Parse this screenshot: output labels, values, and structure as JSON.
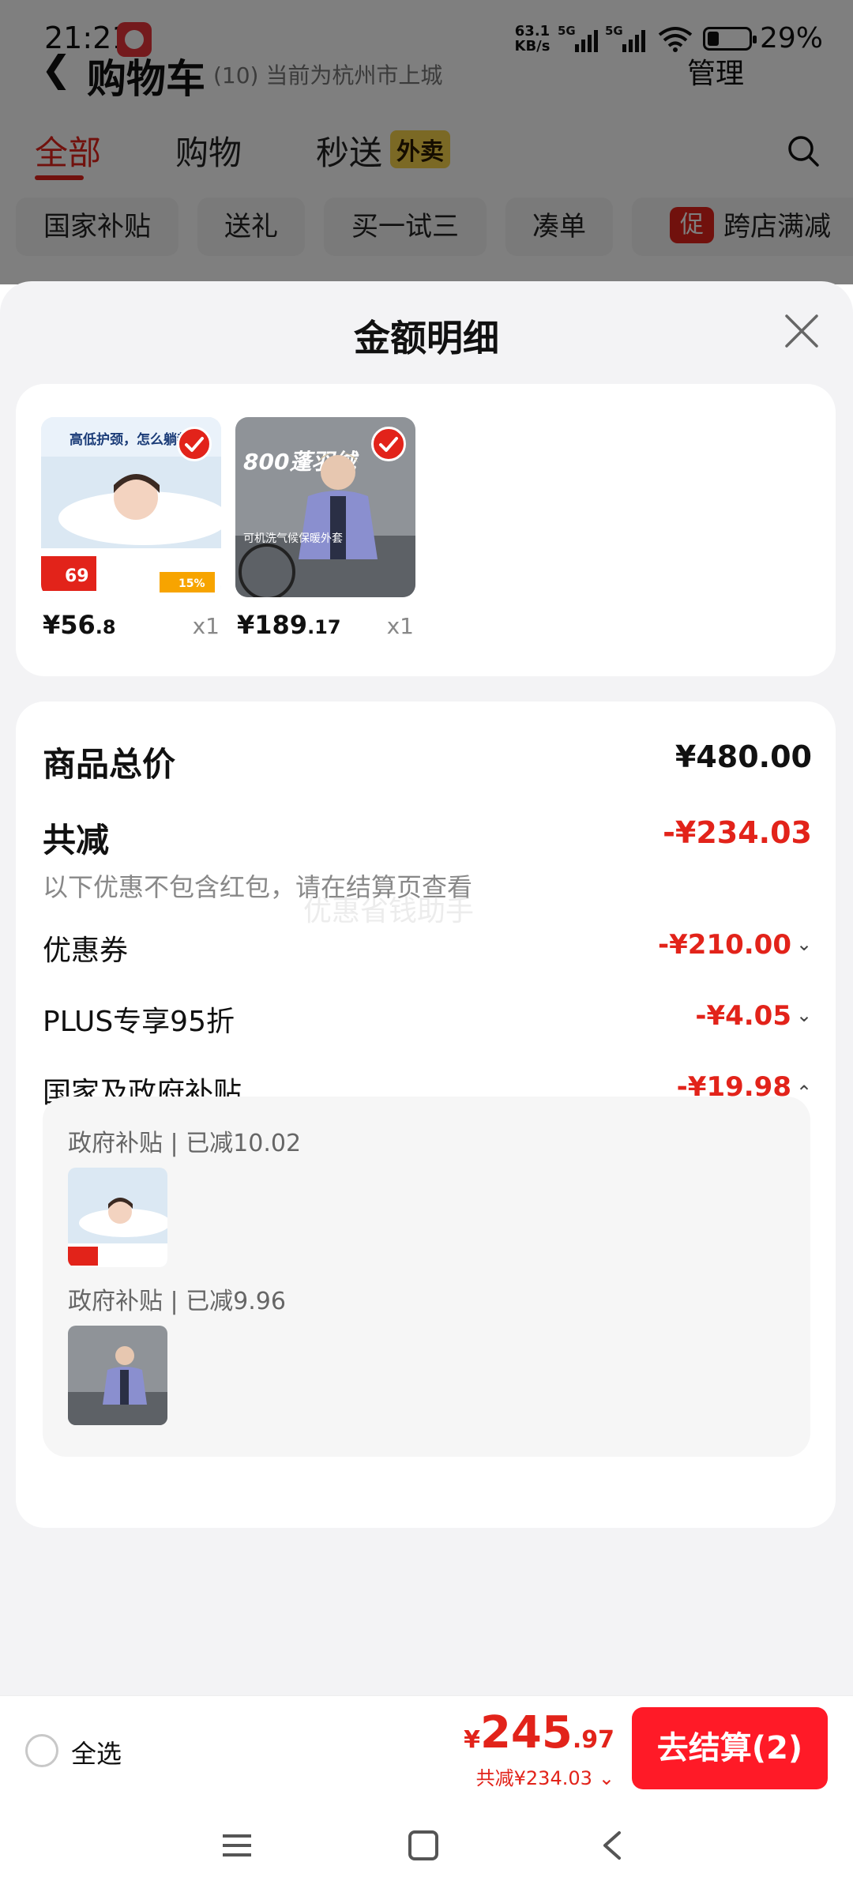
{
  "status_bar": {
    "time": "21:21",
    "net_speed_value": "63.1",
    "net_speed_unit": "KB/s",
    "signal1_label": "5G",
    "signal2_label": "5G",
    "battery_percent": "29%",
    "battery_level": 0.29
  },
  "background_page": {
    "back_icon": "back-arrow-icon",
    "title": "购物车",
    "subtitle": "(10) 当前为杭州市上城",
    "manage_label": "管理",
    "tabs": [
      {
        "label": "全部",
        "active": true
      },
      {
        "label": "购物",
        "active": false
      },
      {
        "label": "秒送",
        "active": false,
        "badge": "外卖"
      }
    ],
    "chips": [
      "国家补贴",
      "送礼",
      "买一试三",
      "凑单",
      "跨店满减"
    ],
    "promo_badge": "促"
  },
  "sheet": {
    "title": "金额明细",
    "close_icon": "close-icon",
    "products": [
      {
        "image": "pillow-product-image",
        "thumb_headline": "高低护颈，怎么躺都舒",
        "thumb_price": "69",
        "thumb_off": "15%",
        "price_symbol": "¥",
        "price_int": "56",
        "price_dec": ".8",
        "qty": "x1",
        "checked": true
      },
      {
        "image": "down-jacket-product-image",
        "thumb_headline": "800蓬羽绒",
        "thumb_caption": "可机洗气候保暖外套",
        "price_symbol": "¥",
        "price_int": "189",
        "price_dec": ".17",
        "qty": "x1",
        "checked": true
      }
    ],
    "summary": {
      "goods_total_label": "商品总价",
      "goods_total_value": "¥480.00",
      "total_discount_label": "共减",
      "total_discount_value": "-¥234.03",
      "note": "以下优惠不包含红包，请在结算页查看",
      "watermark": "优惠省钱助手",
      "items": [
        {
          "label": "优惠券",
          "value": "-¥210.00",
          "expanded": false
        },
        {
          "label": "PLUS专享95折",
          "value": "-¥4.05",
          "expanded": false
        },
        {
          "label": "国家及政府补贴",
          "value": "-¥19.98",
          "expanded": true
        }
      ],
      "subsidy_details": [
        {
          "label": "政府补贴 | 已减10.02",
          "image": "pillow-product-image"
        },
        {
          "label": "政府补贴 | 已减9.96",
          "image": "down-jacket-product-image"
        }
      ]
    }
  },
  "bottom_bar": {
    "select_all_label": "全选",
    "total_symbol": "¥",
    "total_int": "245",
    "total_dec": ".97",
    "saved_text": "共减¥234.03",
    "checkout_label": "去结算(2)"
  },
  "nav_bar": {
    "icons": [
      "menu-icon",
      "home-icon",
      "back-icon"
    ]
  },
  "colors": {
    "accent_red": "#e2231a",
    "checkout_red": "#ff1a27",
    "waimai_yellow": "#f6d24a"
  }
}
